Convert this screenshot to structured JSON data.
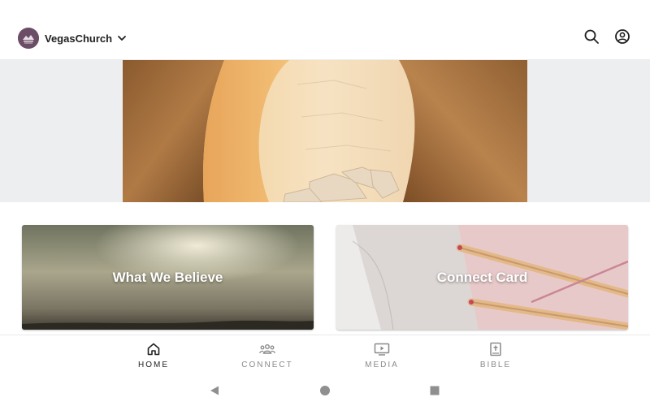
{
  "header": {
    "org_name": "VegasChurch",
    "icons": {
      "org": "church-logo",
      "dropdown": "chevron-down-icon",
      "search": "search-icon",
      "account": "account-circle-icon"
    }
  },
  "hero": {
    "image": "empty-tomb-photo"
  },
  "cards": [
    {
      "title": "What We Believe",
      "image": "clouds-sky-photo"
    },
    {
      "title": "Connect Card",
      "image": "notebook-pencils-photo"
    }
  ],
  "bottom_nav": {
    "items": [
      {
        "label": "HOME",
        "icon": "home-icon",
        "active": true
      },
      {
        "label": "CONNECT",
        "icon": "people-icon",
        "active": false
      },
      {
        "label": "MEDIA",
        "icon": "play-screen-icon",
        "active": false
      },
      {
        "label": "BIBLE",
        "icon": "bible-icon",
        "active": false
      }
    ]
  },
  "system_nav": {
    "icons": [
      "back-icon",
      "home-circle-icon",
      "recents-square-icon"
    ]
  },
  "colors": {
    "accent": "#6b4e66",
    "active_label": "#222222",
    "inactive_label": "#8a8a8a",
    "hero_band": "#edeef0"
  }
}
